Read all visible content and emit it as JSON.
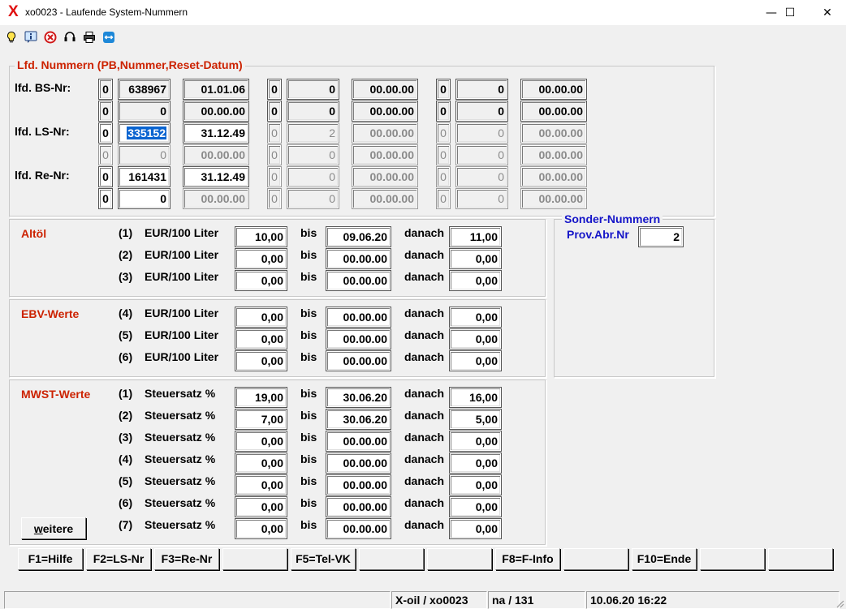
{
  "window": {
    "app_mark": "X",
    "title": "xo0023 - Laufende System-Nummern",
    "minimize": "—",
    "maximize": "☐",
    "close": "✕"
  },
  "toolbar": {
    "icons": [
      "lightbulb-icon",
      "info-icon",
      "cancel-icon",
      "headset-icon",
      "printer-icon",
      "remote-icon"
    ]
  },
  "lfd": {
    "legend": "Lfd. Nummern (PB,Nummer,Reset-Datum)",
    "labels": {
      "bs": "lfd. BS-Nr:",
      "ls": "lfd. LS-Nr:",
      "re": "lfd. Re-Nr:"
    },
    "rows": [
      [
        [
          "0",
          "ro"
        ],
        [
          "638967",
          "ro"
        ],
        [
          "01.01.06",
          "ro"
        ],
        [
          "0",
          "ro"
        ],
        [
          "0",
          "ro"
        ],
        [
          "00.00.00",
          "ro"
        ],
        [
          "0",
          "ro"
        ],
        [
          "0",
          "ro"
        ],
        [
          "00.00.00",
          "ro"
        ]
      ],
      [
        [
          "0",
          "ro"
        ],
        [
          "0",
          "ro"
        ],
        [
          "00.00.00",
          "ro"
        ],
        [
          "0",
          "ro"
        ],
        [
          "0",
          "ro"
        ],
        [
          "00.00.00",
          "ro"
        ],
        [
          "0",
          "ro"
        ],
        [
          "0",
          "ro"
        ],
        [
          "00.00.00",
          "ro"
        ]
      ],
      [
        [
          "0",
          "ed"
        ],
        [
          "335152",
          "sel"
        ],
        [
          "31.12.49",
          "ed"
        ],
        [
          "0",
          "dis"
        ],
        [
          "2",
          "dis"
        ],
        [
          "00.00.00",
          "disb"
        ],
        [
          "0",
          "dis"
        ],
        [
          "0",
          "dis"
        ],
        [
          "00.00.00",
          "disb"
        ]
      ],
      [
        [
          "0",
          "dis"
        ],
        [
          "0",
          "dis"
        ],
        [
          "00.00.00",
          "disb"
        ],
        [
          "0",
          "dis"
        ],
        [
          "0",
          "dis"
        ],
        [
          "00.00.00",
          "disb"
        ],
        [
          "0",
          "dis"
        ],
        [
          "0",
          "dis"
        ],
        [
          "00.00.00",
          "disb"
        ]
      ],
      [
        [
          "0",
          "ed"
        ],
        [
          "161431",
          "ed"
        ],
        [
          "31.12.49",
          "ed"
        ],
        [
          "0",
          "dis"
        ],
        [
          "0",
          "dis"
        ],
        [
          "00.00.00",
          "disb"
        ],
        [
          "0",
          "dis"
        ],
        [
          "0",
          "dis"
        ],
        [
          "00.00.00",
          "disb"
        ]
      ],
      [
        [
          "0",
          "ed"
        ],
        [
          "0",
          "ed"
        ],
        [
          "00.00.00",
          "disb"
        ],
        [
          "0",
          "dis"
        ],
        [
          "0",
          "dis"
        ],
        [
          "00.00.00",
          "disb"
        ],
        [
          "0",
          "dis"
        ],
        [
          "0",
          "dis"
        ],
        [
          "00.00.00",
          "disb"
        ]
      ]
    ]
  },
  "altoel": {
    "title": "Altöl",
    "rows": [
      {
        "num": "(1)",
        "label": "EUR/100  Liter",
        "value": "10,00",
        "bis": "bis",
        "date": "09.06.20",
        "danach": "danach",
        "after": "11,00"
      },
      {
        "num": "(2)",
        "label": "EUR/100  Liter",
        "value": "0,00",
        "bis": "bis",
        "date": "00.00.00",
        "danach": "danach",
        "after": "0,00"
      },
      {
        "num": "(3)",
        "label": "EUR/100  Liter",
        "value": "0,00",
        "bis": "bis",
        "date": "00.00.00",
        "danach": "danach",
        "after": "0,00"
      }
    ]
  },
  "ebv": {
    "title": "EBV-Werte",
    "rows": [
      {
        "num": "(4)",
        "label": "EUR/100  Liter",
        "value": "0,00",
        "bis": "bis",
        "date": "00.00.00",
        "danach": "danach",
        "after": "0,00"
      },
      {
        "num": "(5)",
        "label": "EUR/100  Liter",
        "value": "0,00",
        "bis": "bis",
        "date": "00.00.00",
        "danach": "danach",
        "after": "0,00"
      },
      {
        "num": "(6)",
        "label": "EUR/100  Liter",
        "value": "0,00",
        "bis": "bis",
        "date": "00.00.00",
        "danach": "danach",
        "after": "0,00"
      }
    ]
  },
  "mwst": {
    "title": "MWST-Werte",
    "more_button": "weitere",
    "rows": [
      {
        "num": "(1)",
        "label": "Steuersatz %",
        "value": "19,00",
        "bis": "bis",
        "date": "30.06.20",
        "danach": "danach",
        "after": "16,00"
      },
      {
        "num": "(2)",
        "label": "Steuersatz %",
        "value": "7,00",
        "bis": "bis",
        "date": "30.06.20",
        "danach": "danach",
        "after": "5,00"
      },
      {
        "num": "(3)",
        "label": "Steuersatz %",
        "value": "0,00",
        "bis": "bis",
        "date": "00.00.00",
        "danach": "danach",
        "after": "0,00"
      },
      {
        "num": "(4)",
        "label": "Steuersatz %",
        "value": "0,00",
        "bis": "bis",
        "date": "00.00.00",
        "danach": "danach",
        "after": "0,00"
      },
      {
        "num": "(5)",
        "label": "Steuersatz %",
        "value": "0,00",
        "bis": "bis",
        "date": "00.00.00",
        "danach": "danach",
        "after": "0,00"
      },
      {
        "num": "(6)",
        "label": "Steuersatz %",
        "value": "0,00",
        "bis": "bis",
        "date": "00.00.00",
        "danach": "danach",
        "after": "0,00"
      },
      {
        "num": "(7)",
        "label": "Steuersatz %",
        "value": "0,00",
        "bis": "bis",
        "date": "00.00.00",
        "danach": "danach",
        "after": "0,00"
      }
    ]
  },
  "sonder": {
    "title": "Sonder-Nummern",
    "prov_label": "Prov.Abr.Nr",
    "prov_value": "2"
  },
  "fkeys": [
    "F1=Hilfe",
    "F2=LS-Nr",
    "F3=Re-Nr",
    "",
    "F5=Tel-VK",
    "",
    "",
    "F8=F-Info",
    "",
    "F10=Ende",
    "",
    ""
  ],
  "status": {
    "system": "X-oil / xo0023",
    "user": "na / 131",
    "datetime": "10.06.20 16:22"
  },
  "colors": {
    "label_red": "#cc2200",
    "label_blue": "#1515c8",
    "selection": "#0a64d0"
  }
}
